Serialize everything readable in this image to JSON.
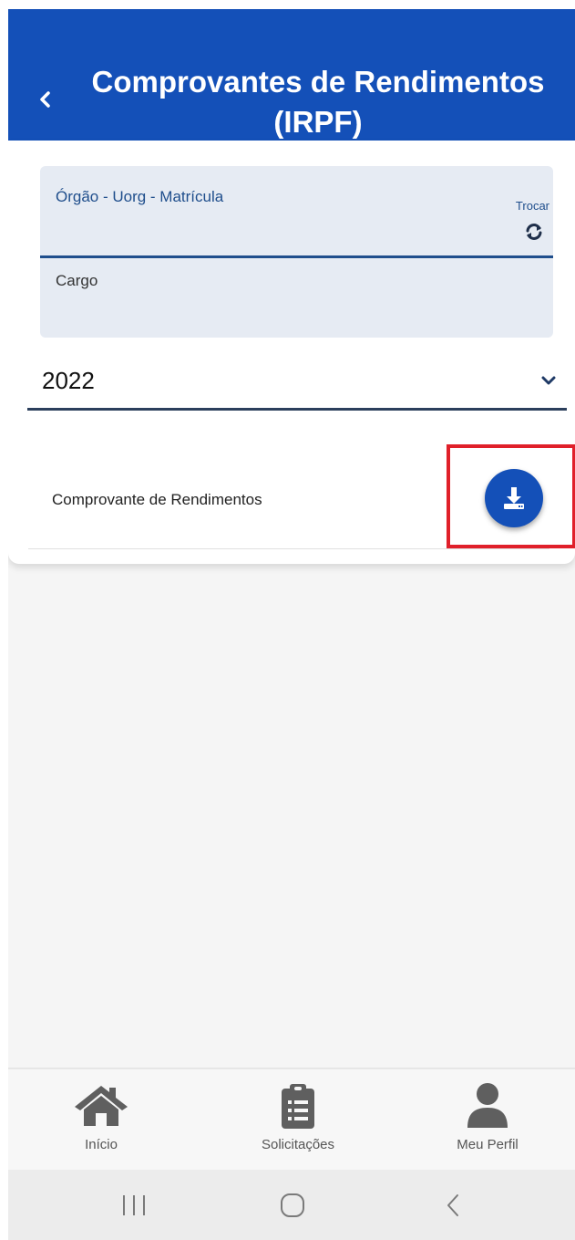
{
  "header": {
    "title_line1": "Comprovantes de Rendimentos",
    "title_line2": "(IRPF)",
    "back_icon": "chevron-left-icon",
    "background_color": "#1450b8"
  },
  "info_card": {
    "orgao_label": "Órgão - Uorg - Matrícula",
    "trocar_label": "Trocar",
    "trocar_icon": "refresh-icon",
    "cargo_label": "Cargo"
  },
  "year_select": {
    "value": "2022",
    "icon": "chevron-down-icon"
  },
  "document_list": [
    {
      "label": "Comprovante de Rendimentos",
      "action_icon": "download-icon"
    }
  ],
  "bottom_nav": {
    "items": [
      {
        "label": "Início",
        "icon": "home-icon"
      },
      {
        "label": "Solicitações",
        "icon": "clipboard-list-icon"
      },
      {
        "label": "Meu Perfil",
        "icon": "user-icon"
      }
    ]
  },
  "system_nav": {
    "icons": [
      "recent-apps-icon",
      "home-circle-icon",
      "back-icon"
    ]
  },
  "colors": {
    "primary": "#1450b8",
    "highlight": "#e0202a",
    "label_blue": "#1f4e8c"
  }
}
